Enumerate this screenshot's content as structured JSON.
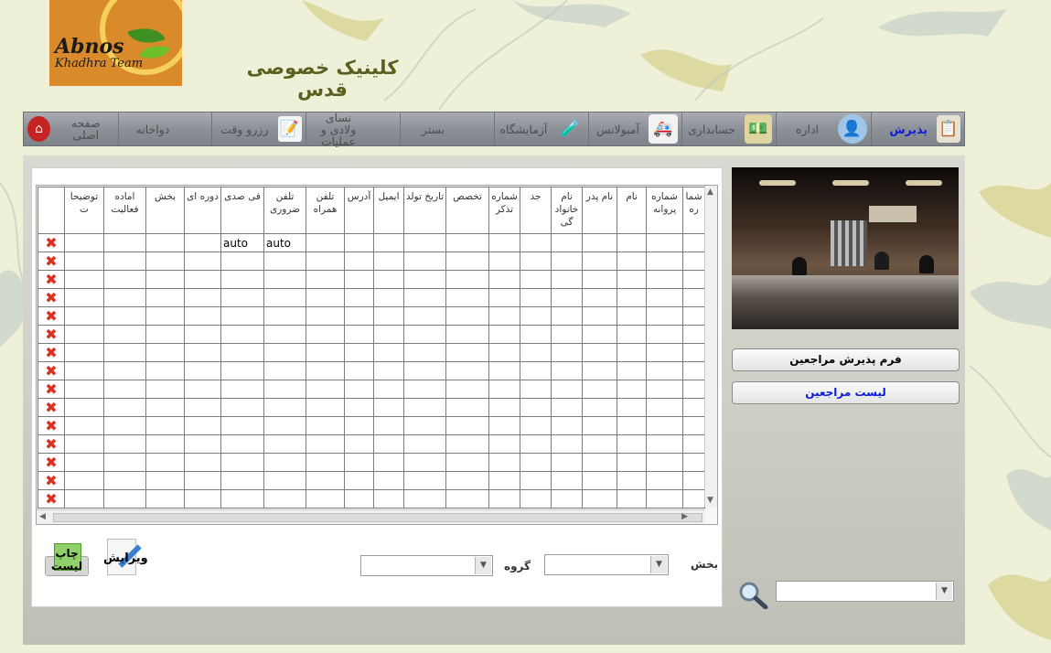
{
  "logo": {
    "brand": "Abnos",
    "subbrand": "Khadhra Team"
  },
  "clinic_title": "کلینیک خصوصی قدس",
  "nav": {
    "items": [
      {
        "label": "پذیرش",
        "icon": "clipboard-icon",
        "active": true
      },
      {
        "label": "اداره",
        "icon": "user-icon"
      },
      {
        "label": "حسابداری",
        "icon": "money-icon"
      },
      {
        "label": "آمبولانس",
        "icon": "ambulance-icon"
      },
      {
        "label": "آزمایشگاه",
        "icon": "test-tube-icon"
      },
      {
        "label": "بستر",
        "icon": "bed-icon"
      },
      {
        "label": "نسای ولادی و عملیات",
        "icon": "surgery-icon"
      },
      {
        "label": "رزرو وقت",
        "icon": "calendar-icon"
      },
      {
        "label": "دواخانه",
        "icon": "pharmacy-icon"
      },
      {
        "label": "صفحه اصلی",
        "icon": "home-icon"
      }
    ]
  },
  "grid": {
    "columns": [
      "شما ره",
      "شماره پروانه",
      "نام",
      "نام پدر",
      "نام خانواد گی",
      "جد",
      "شماره تذکر",
      "تخصص",
      "تاریخ تولد",
      "ایمیل",
      "آدرس",
      "تلفن همراه",
      "تلفن ضروری",
      "فی صدی",
      "دوره ای",
      "بخش",
      "اماده فعالیت",
      "توضیحا ت"
    ],
    "first_row_values": {
      "تلفن ضروری": "auto",
      "فی صدی": "auto"
    },
    "row_count": 15
  },
  "controls": {
    "section_label": "بخش",
    "group_label": "گروه",
    "edit_label": "ویرایش",
    "print_label": "چاپ لیست"
  },
  "side": {
    "reception_form_button": "فرم پذیرش مراجعین",
    "patient_list_button": "لیست مراجعین",
    "reception_form_color": "#000000",
    "patient_list_color": "#0b1bd6"
  },
  "colors": {
    "nav_active": "#0b1bd6",
    "title": "#5a6020",
    "delete_mark": "#d83020"
  }
}
